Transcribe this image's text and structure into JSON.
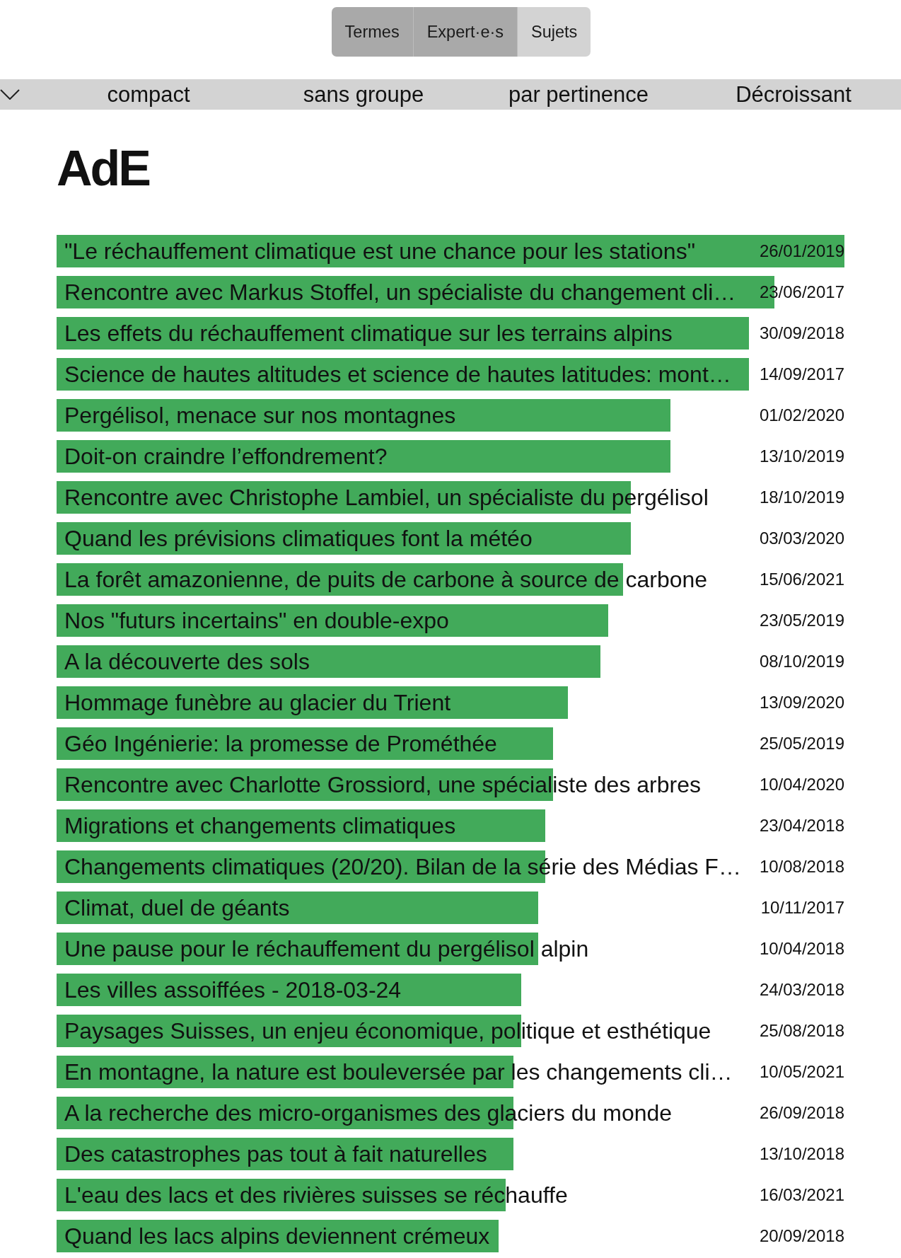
{
  "tabs": [
    {
      "label": "Termes",
      "selected": true
    },
    {
      "label": "Expert·e·s",
      "selected": true
    },
    {
      "label": "Sujets",
      "selected": false
    }
  ],
  "toolbar": {
    "display": "compact",
    "grouping": "sans groupe",
    "sort": "par pertinence",
    "order": "Décroissant"
  },
  "heading": "AdE",
  "results": [
    {
      "title": "\"Le réchauffement climatique est une chance pour les stations\"",
      "date": "26/01/2019",
      "level": 1.0
    },
    {
      "title": "Rencontre avec Markus Stoffel, un spécialiste du changement cli…",
      "date": "23/06/2017",
      "level": 0.911
    },
    {
      "title": "Les effets du réchauffement climatique sur les terrains alpins",
      "date": "30/09/2018",
      "level": 0.879
    },
    {
      "title": "Science de hautes altitudes et science de hautes latitudes: mont…",
      "date": "14/09/2017",
      "level": 0.879
    },
    {
      "title": "Pergélisol, menace sur nos montagnes",
      "date": "01/02/2020",
      "level": 0.779
    },
    {
      "title": "Doit-on craindre l’effondrement?",
      "date": "13/10/2019",
      "level": 0.779
    },
    {
      "title": "Rencontre avec Christophe Lambiel, un spécialiste du pergélisol",
      "date": "18/10/2019",
      "level": 0.729
    },
    {
      "title": "Quand les prévisions climatiques font la météo",
      "date": "03/03/2020",
      "level": 0.729
    },
    {
      "title": "La forêt amazonienne, de puits de carbone à source de carbone",
      "date": "15/06/2021",
      "level": 0.719
    },
    {
      "title": "Nos \"futurs incertains\" en double-expo",
      "date": "23/05/2019",
      "level": 0.7
    },
    {
      "title": "A la découverte des sols",
      "date": "08/10/2019",
      "level": 0.69
    },
    {
      "title": "Hommage funèbre au glacier du Trient",
      "date": "13/09/2020",
      "level": 0.649
    },
    {
      "title": "Géo Ingénierie: la promesse de Prométhée",
      "date": "25/05/2019",
      "level": 0.63
    },
    {
      "title": "Rencontre avec Charlotte Grossiord, une spécialiste des arbres",
      "date": "10/04/2020",
      "level": 0.63
    },
    {
      "title": "Migrations et changements climatiques",
      "date": "23/04/2018",
      "level": 0.62
    },
    {
      "title": "Changements climatiques (20/20). Bilan de la série des Médias F…",
      "date": "10/08/2018",
      "level": 0.62
    },
    {
      "title": "Climat, duel de géants",
      "date": "10/11/2017",
      "level": 0.611
    },
    {
      "title": "Une pause pour le réchauffement du pergélisol alpin",
      "date": "10/04/2018",
      "level": 0.611
    },
    {
      "title": "Les villes assoiffées - 2018-03-24",
      "date": "24/03/2018",
      "level": 0.59
    },
    {
      "title": "Paysages Suisses, un enjeu économique, politique et esthétique",
      "date": "25/08/2018",
      "level": 0.59
    },
    {
      "title": "En montagne, la nature est bouleversée par les changements cli…",
      "date": "10/05/2021",
      "level": 0.58
    },
    {
      "title": "A la recherche des micro-organismes des glaciers du monde",
      "date": "26/09/2018",
      "level": 0.58
    },
    {
      "title": "Des catastrophes pas tout à fait naturelles",
      "date": "13/10/2018",
      "level": 0.58
    },
    {
      "title": "L'eau des lacs et des rivières suisses se réchauffe",
      "date": "16/03/2021",
      "level": 0.57
    },
    {
      "title": "Quand les lacs alpins deviennent crémeux",
      "date": "20/09/2018",
      "level": 0.561
    }
  ]
}
